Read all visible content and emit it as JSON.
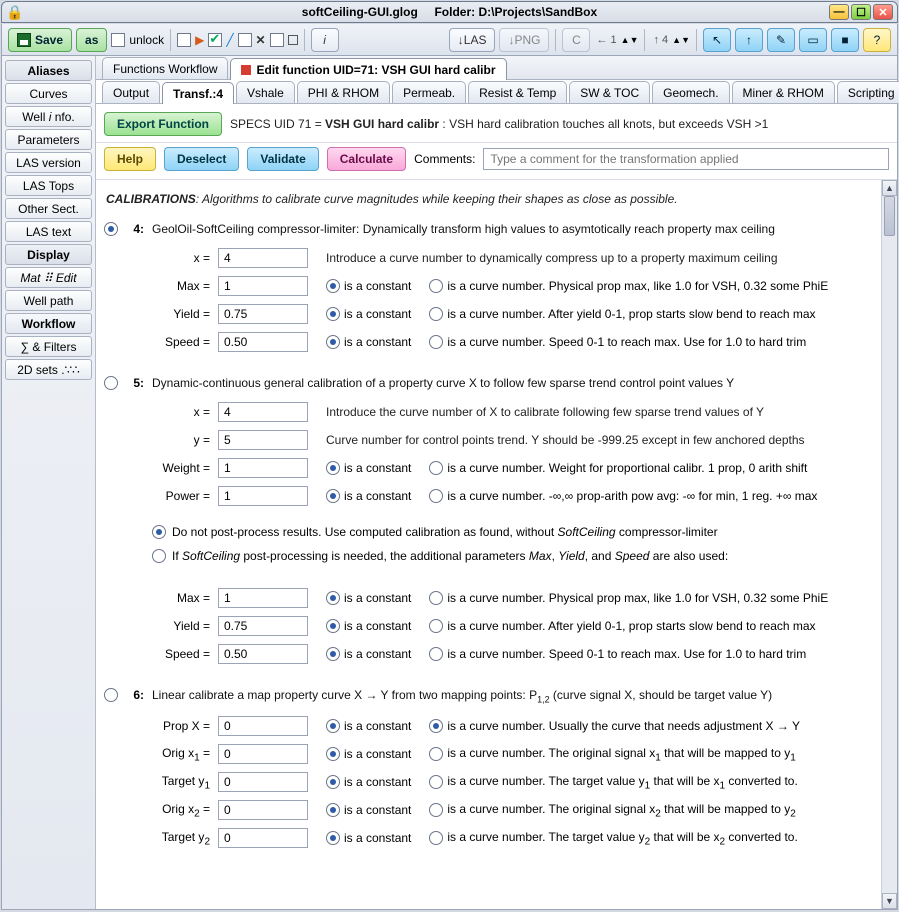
{
  "title": {
    "file": "softCeiling-GUI.glog",
    "folder_label": "Folder:",
    "folder_path": "D:\\Projects\\SandBox"
  },
  "toolbar": {
    "save": "Save",
    "as": "as",
    "unlock": "unlock",
    "las": "↓LAS",
    "png": "↓PNG",
    "c": "C",
    "info": "i",
    "help": "?",
    "arrow_left": "← 1",
    "arrow_up": "↑ 4"
  },
  "leftnav": [
    {
      "label": "Aliases",
      "kind": "heading"
    },
    {
      "label": "Curves"
    },
    {
      "label": "Well i nfo.",
      "ital_i": true
    },
    {
      "label": "Parameters"
    },
    {
      "label": "LAS version"
    },
    {
      "label": "LAS Tops"
    },
    {
      "label": "Other Sect."
    },
    {
      "label": "LAS text"
    },
    {
      "label": "Display",
      "kind": "heading"
    },
    {
      "label": "Mat ⠿ Edit",
      "ital": true
    },
    {
      "label": "Well path"
    },
    {
      "label": "Workflow",
      "kind": "active"
    },
    {
      "label": "∑ & Filters"
    },
    {
      "label": "2D sets .∵∴"
    }
  ],
  "top_tabs": [
    {
      "label": "Functions Workflow"
    },
    {
      "label": "Edit function UID=71: VSH GUI hard calibr",
      "active": true,
      "marker": true
    }
  ],
  "sub_tabs": [
    "Output",
    "Transf.:4",
    "Vshale",
    "PHI & RHOM",
    "Permeab.",
    "Resist & Temp",
    "SW & TOC",
    "Geomech.",
    "Miner & RHOM",
    "Scripting"
  ],
  "sub_tabs_active": 1,
  "subhdr": {
    "export": "Export Function",
    "specs_pre": "SPECS UID 71 = ",
    "specs_name": "VSH GUI hard calibr",
    "specs_post": " : VSH hard calibration touches all knots, but exceeds VSH >1",
    "help": "Help",
    "deselect": "Deselect",
    "validate": "Validate",
    "calculate": "Calculate",
    "comments_label": "Comments:",
    "comments_placeholder": "Type a comment for the transformation applied"
  },
  "calib_header": {
    "term": "CALIBRATIONS",
    "rest": ": Algorithms to calibrate curve magnitudes while keeping their shapes as close as possible."
  },
  "radio_const": "is a constant",
  "radio_curve_pre": "is a curve number.",
  "opt4": {
    "num": "4:",
    "desc": "GeolOil-SoftCeiling compressor-limiter: Dynamically transform high values to asymtotically reach property max ceiling",
    "rows": [
      {
        "label": "x =",
        "value": "4",
        "hint": "Introduce a curve number to dynamically compress up to a property maximum ceiling",
        "hint_only": true
      },
      {
        "label": "Max =",
        "value": "1",
        "const": true,
        "curvedesc": "Physical prop max, like 1.0 for VSH, 0.32 some PhiE"
      },
      {
        "label": "Yield =",
        "value": "0.75",
        "const": true,
        "curvedesc": "After yield 0-1, prop starts slow bend to reach max"
      },
      {
        "label": "Speed =",
        "value": "0.50",
        "const": true,
        "curvedesc": "Speed 0-1 to reach max. Use for 1.0 to hard trim"
      }
    ],
    "selected": true
  },
  "opt5": {
    "num": "5:",
    "desc": "Dynamic-continuous general calibration of a property curve X to follow few sparse trend control point values Y",
    "rows": [
      {
        "label": "x =",
        "value": "4",
        "hint": "Introduce the curve number of X to calibrate following few sparse trend values of Y",
        "hint_only": true
      },
      {
        "label": "y =",
        "value": "5",
        "hint": "Curve number for control points trend. Y should be -999.25 except in few anchored depths",
        "hint_only": true
      },
      {
        "label": "Weight =",
        "value": "1",
        "const": true,
        "curvedesc": "Weight for proportional calibr. 1 prop, 0 arith shift"
      },
      {
        "label": "Power =",
        "value": "1",
        "const": true,
        "curvedesc": "-∞,∞ prop-arith pow avg: -∞ for min, 1 reg. +∞ max"
      }
    ],
    "post": [
      {
        "on": true,
        "pre": "Do not post-process results. Use computed calibration as found, without ",
        "ital": "SoftCeiling",
        "post": " compressor-limiter"
      },
      {
        "on": false,
        "pre": "If ",
        "ital": "SoftCeiling",
        "post": " post-processing is needed, the additional parameters ",
        "ital2": "Max",
        "mid": ", ",
        "ital3": "Yield",
        "mid2": ", and ",
        "ital4": "Speed",
        "tail": " are also used:"
      }
    ],
    "rows2": [
      {
        "label": "Max =",
        "value": "1",
        "const": true,
        "curvedesc": "Physical prop max, like 1.0 for VSH, 0.32 some PhiE"
      },
      {
        "label": "Yield =",
        "value": "0.75",
        "const": true,
        "curvedesc": "After yield 0-1, prop starts slow bend to reach max"
      },
      {
        "label": "Speed =",
        "value": "0.50",
        "const": true,
        "curvedesc": "Speed 0-1 to reach max. Use for 1.0 to hard trim"
      }
    ]
  },
  "opt6": {
    "num": "6:",
    "desc_pre": "Linear calibrate a map property curve X → Y from two mapping points: P",
    "desc_sub": "1,2",
    "desc_post": " (curve signal X, should be target value Y)",
    "rows": [
      {
        "label": "Prop X =",
        "value": "0",
        "const": true,
        "curve_sel": true,
        "curvedesc": "Usually the curve that needs adjustment X → Y"
      },
      {
        "label_html": "Orig x<sub>1</sub> =",
        "value": "0",
        "const": true,
        "curvedesc_html": "The original signal x<sub>1</sub> that will be mapped to y<sub>1</sub>"
      },
      {
        "label_html": "Target y<sub>1</sub>",
        "value": "0",
        "const": true,
        "curvedesc_html": "The target value y<sub>1</sub> that will be x<sub>1</sub> converted to."
      },
      {
        "label_html": "Orig x<sub>2</sub> =",
        "value": "0",
        "const": true,
        "curvedesc_html": "The original signal x<sub>2</sub> that will be mapped to y<sub>2</sub>"
      },
      {
        "label_html": "Target y<sub>2</sub>",
        "value": "0",
        "const": true,
        "curvedesc_html": "The target value y<sub>2</sub> that will be x<sub>2</sub> converted to."
      }
    ]
  }
}
